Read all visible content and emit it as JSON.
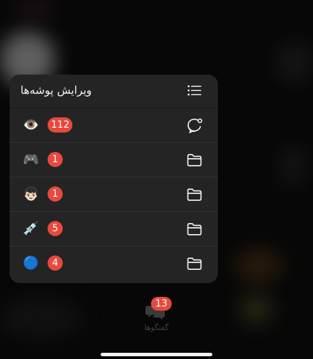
{
  "menu": {
    "title": "ویرایش پوشه‌ها",
    "header_icon": "list-icon",
    "rows": [
      {
        "emoji": "👁️",
        "badge": "112",
        "icon": "new-chat-icon"
      },
      {
        "emoji": "🎮",
        "badge": "1",
        "icon": "folder-icon"
      },
      {
        "emoji": "👦🏻",
        "badge": "1",
        "icon": "folder-icon"
      },
      {
        "emoji": "💉",
        "badge": "5",
        "icon": "folder-icon"
      },
      {
        "emoji": "🔵",
        "badge": "4",
        "icon": "folder-icon"
      }
    ]
  },
  "tabbar": {
    "chats_label": "گفتگوها",
    "chats_badge": "13"
  },
  "colors": {
    "badge": "#e8493f",
    "menu_background": "#242424",
    "page_background": "#070707"
  }
}
